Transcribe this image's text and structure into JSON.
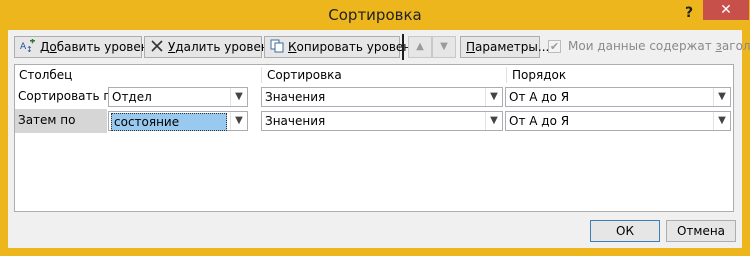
{
  "window": {
    "title": "Сортировка",
    "help_glyph": "?",
    "close_glyph": "✕",
    "frame_color": "#edb61d"
  },
  "toolbar": {
    "add_level_label": [
      "Д",
      "о",
      "бавить уровень"
    ],
    "delete_level_label": [
      "",
      "У",
      "далить уровень"
    ],
    "copy_level_label": [
      "",
      "К",
      "опировать уровень"
    ],
    "move_up_glyph": "▲",
    "move_down_glyph": "▼",
    "options_label": [
      "",
      "П",
      "араметры..."
    ],
    "headers_checkbox_label": [
      "Мои данные содержат ",
      "з",
      "аголовки"
    ],
    "headers_checkbox_checked": true
  },
  "grid": {
    "columns": [
      "Столбец",
      "Сортировка",
      "Порядок"
    ],
    "rows": [
      {
        "label": "Сортировать по",
        "column": "Отдел",
        "sort_on": "Значения",
        "order": "От А до Я",
        "selected": false
      },
      {
        "label": "Затем по",
        "column": "состояние",
        "sort_on": "Значения",
        "order": "От А до Я",
        "selected": true
      }
    ]
  },
  "footer": {
    "ok_label": "ОК",
    "cancel_label": "Отмена"
  }
}
